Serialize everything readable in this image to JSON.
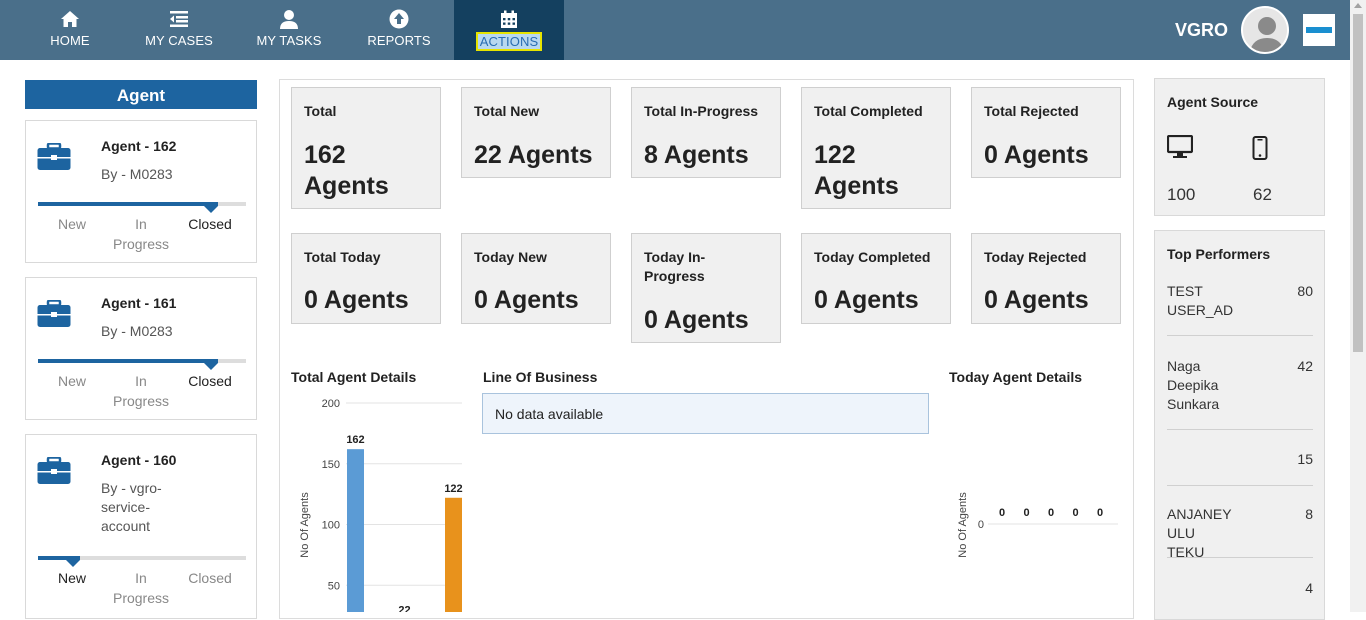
{
  "nav": {
    "items": [
      {
        "label": "HOME",
        "icon": "home-icon"
      },
      {
        "label": "MY CASES",
        "icon": "cases-icon"
      },
      {
        "label": "MY TASKS",
        "icon": "person-icon"
      },
      {
        "label": "REPORTS",
        "icon": "upload-circle-icon"
      },
      {
        "label": "ACTIONS",
        "icon": "calendar-icon",
        "active": true
      }
    ],
    "user": "VGRO"
  },
  "sidebar": {
    "header": "Agent",
    "cards": [
      {
        "title": "Agent - 162",
        "by": "By - M0283",
        "steps": [
          "New",
          "In Progress",
          "Closed"
        ],
        "current": "Closed"
      },
      {
        "title": "Agent - 161",
        "by": "By - M0283",
        "steps": [
          "New",
          "In Progress",
          "Closed"
        ],
        "current": "Closed"
      },
      {
        "title": "Agent - 160",
        "by": "By - vgro-service-account",
        "steps": [
          "New",
          "In Progress",
          "Closed"
        ],
        "current": "New"
      }
    ]
  },
  "stats": {
    "row1": [
      {
        "label": "Total",
        "value": "162 Agents"
      },
      {
        "label": "Total New",
        "value": "22 Agents"
      },
      {
        "label": "Total In-Progress",
        "value": "8 Agents"
      },
      {
        "label": "Total Completed",
        "value": "122 Agents"
      },
      {
        "label": "Total Rejected",
        "value": "0 Agents"
      }
    ],
    "row2": [
      {
        "label": "Total Today",
        "value": "0 Agents"
      },
      {
        "label": "Today New",
        "value": "0 Agents"
      },
      {
        "label": "Today In-Progress",
        "value": "0 Agents"
      },
      {
        "label": "Today Completed",
        "value": "0 Agents"
      },
      {
        "label": "Today Rejected",
        "value": "0 Agents"
      }
    ]
  },
  "sections": {
    "total_agent_details": "Total Agent Details",
    "line_of_business": "Line Of Business",
    "no_data": "No data available",
    "today_agent_details": "Today Agent Details"
  },
  "chart_data": [
    {
      "type": "bar",
      "title": "Total Agent Details",
      "ylabel": "No Of Agents",
      "yticks": [
        50,
        100,
        150,
        200
      ],
      "ylim": [
        0,
        200
      ],
      "bars": [
        {
          "value": 162,
          "color": "#5b9bd5"
        },
        {
          "value": 22,
          "color": "#5b9bd5"
        },
        {
          "value": 122,
          "color": "#e8921c"
        }
      ]
    },
    {
      "type": "bar",
      "title": "Today Agent Details",
      "ylabel": "No Of Agents",
      "yticks": [
        0
      ],
      "values": [
        0,
        0,
        0,
        0,
        0
      ]
    }
  ],
  "agent_source": {
    "title": "Agent Source",
    "desktop": "100",
    "mobile": "62"
  },
  "top_performers": {
    "title": "Top Performers",
    "items": [
      {
        "name": "TEST USER_AD",
        "count": "80"
      },
      {
        "name": "Naga Deepika Sunkara",
        "count": "42"
      },
      {
        "name": "",
        "count": "15"
      },
      {
        "name": "ANJANEY ULU TEKU",
        "count": "8"
      },
      {
        "name": "",
        "count": "4"
      }
    ]
  }
}
